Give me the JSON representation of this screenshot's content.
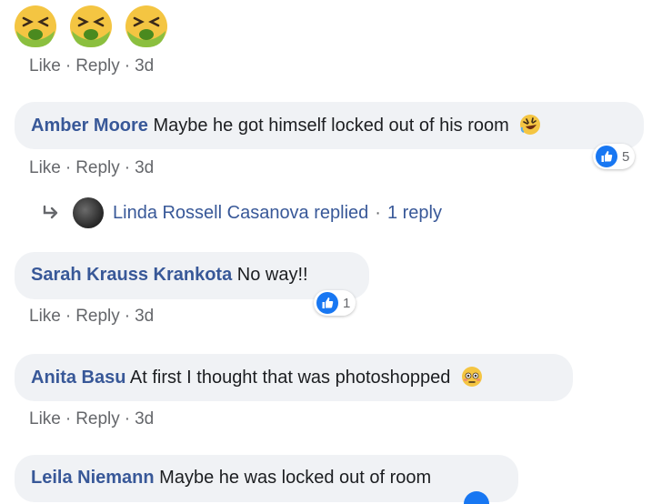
{
  "top_comment": {
    "emoji_icons": [
      "nauseated-face",
      "nauseated-face",
      "nauseated-face"
    ],
    "like_label": "Like",
    "reply_label": "Reply",
    "time": "3d"
  },
  "comments": [
    {
      "author": "Amber Moore",
      "text": "Maybe he got himself locked out of his room",
      "emoji": "rolling-on-floor-laughing",
      "reaction_icon": "like-icon",
      "reaction_count": "5",
      "like_label": "Like",
      "reply_label": "Reply",
      "time": "3d"
    },
    {
      "author": "Sarah Krauss Krankota",
      "text": "No way!!",
      "reaction_icon": "like-icon",
      "reaction_count": "1",
      "like_label": "Like",
      "reply_label": "Reply",
      "time": "3d"
    },
    {
      "author": "Anita Basu",
      "text": "At first I thought that was photoshopped",
      "emoji": "flushed-face",
      "like_label": "Like",
      "reply_label": "Reply",
      "time": "3d"
    },
    {
      "author": "Leila Niemann",
      "text": "Maybe he was locked out of room"
    }
  ],
  "reply_summary": {
    "text": "Linda Rossell Casanova replied",
    "count": "1 reply"
  },
  "colors": {
    "author": "#385898",
    "bubble": "#f0f2f5",
    "meta": "#65676b",
    "like_blue": "#1877f2"
  },
  "separator": "·"
}
